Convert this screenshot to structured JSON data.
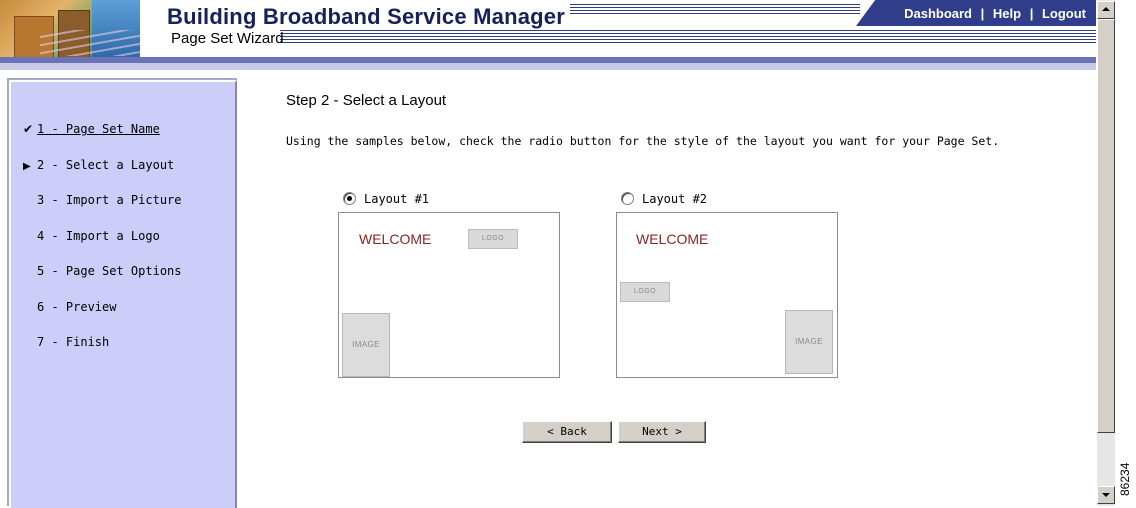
{
  "header": {
    "title": "Building Broadband Service Manager",
    "subtitle": "Page Set Wizard",
    "nav_links": [
      "Dashboard",
      "Help",
      "Logout"
    ],
    "separator": "|"
  },
  "sidebar": {
    "items": [
      {
        "label": "1 - Page Set Name",
        "state": "done",
        "mark": "✔"
      },
      {
        "label": "2 - Select a Layout",
        "state": "current",
        "mark": "▶"
      },
      {
        "label": "3 - Import a Picture",
        "state": "pending",
        "mark": ""
      },
      {
        "label": "4 - Import a Logo",
        "state": "pending",
        "mark": ""
      },
      {
        "label": "5 - Page Set Options",
        "state": "pending",
        "mark": ""
      },
      {
        "label": "6 - Preview",
        "state": "pending",
        "mark": ""
      },
      {
        "label": "7 - Finish",
        "state": "pending",
        "mark": ""
      }
    ]
  },
  "main": {
    "step_title": "Step 2 - Select a Layout",
    "instructions": "Using the samples below, check the radio button for the style of the layout you want for your Page Set.",
    "layouts": [
      {
        "label": "Layout #1",
        "selected": true,
        "welcome": "WELCOME",
        "logo": "LOGO",
        "image": "IMAGE"
      },
      {
        "label": "Layout #2",
        "selected": false,
        "welcome": "WELCOME",
        "logo": "LOGO",
        "image": "IMAGE"
      }
    ],
    "buttons": {
      "back": "< Back",
      "next": "Next >"
    }
  },
  "figure_number": "86234",
  "colors": {
    "header_navy": "#2f3d8a",
    "title_navy": "#16215c",
    "sidebar_bg": "#cdcdf9",
    "welcome_red": "#8a2525"
  }
}
